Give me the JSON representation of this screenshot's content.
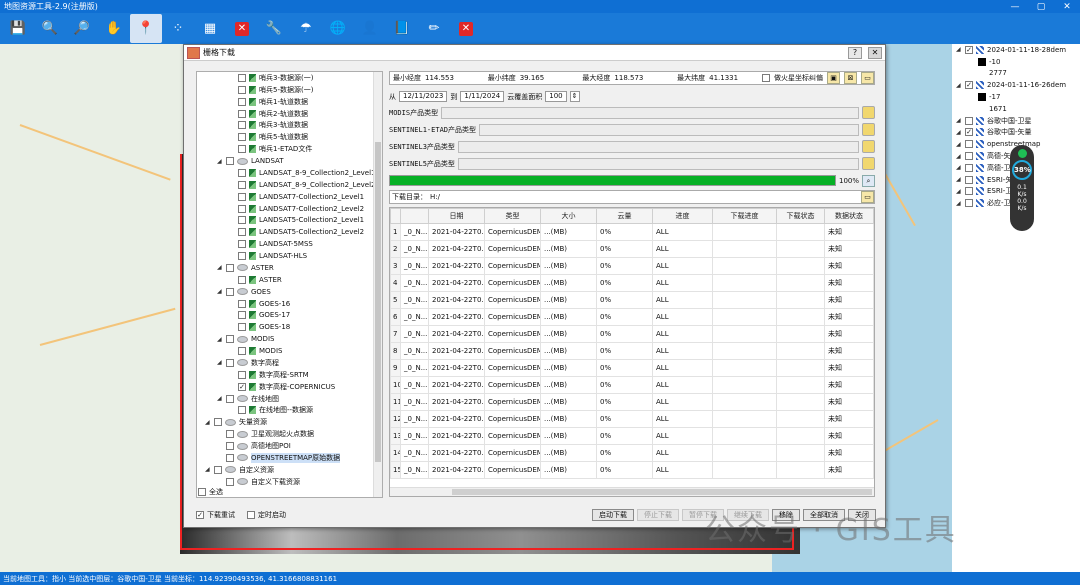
{
  "app": {
    "title": "地图资源工具-2.9(注册版)",
    "min": "—",
    "max": "▢",
    "close": "✕"
  },
  "toolbar": [
    {
      "name": "save-icon",
      "glyph": "💾"
    },
    {
      "name": "zoom-in-icon",
      "glyph": "🔍"
    },
    {
      "name": "zoom-out-icon",
      "glyph": "🔎"
    },
    {
      "name": "pan-hand-icon",
      "glyph": "✋"
    },
    {
      "name": "location-icon",
      "glyph": "📍",
      "active": true
    },
    {
      "name": "select-icon",
      "glyph": "⁘"
    },
    {
      "name": "grid-select-icon",
      "glyph": "▦"
    },
    {
      "name": "clear-icon",
      "glyph": "✕",
      "red": true
    },
    {
      "name": "tools-icon",
      "glyph": "🔧"
    },
    {
      "name": "umbrella-icon",
      "glyph": "☂"
    },
    {
      "name": "globe-icon",
      "glyph": "🌐"
    },
    {
      "name": "user-icon",
      "glyph": "👤"
    },
    {
      "name": "book-icon",
      "glyph": "📘"
    },
    {
      "name": "pencil-icon",
      "glyph": "✏"
    },
    {
      "name": "close-all-icon",
      "glyph": "✕",
      "red": true
    }
  ],
  "layers": [
    {
      "type": "group",
      "checked": true,
      "label": "2024-01-11-18-28dem"
    },
    {
      "type": "value",
      "label": "-10",
      "swatch": true
    },
    {
      "type": "value",
      "label": "2777"
    },
    {
      "type": "group",
      "checked": true,
      "label": "2024-01-11-16-26dem"
    },
    {
      "type": "value",
      "label": "-17",
      "swatch": true
    },
    {
      "type": "value",
      "label": "1671"
    },
    {
      "type": "item",
      "checked": false,
      "label": "谷歌中国-卫星"
    },
    {
      "type": "item",
      "checked": true,
      "label": "谷歌中国-矢量"
    },
    {
      "type": "item",
      "checked": false,
      "label": "openstreetmap"
    },
    {
      "type": "item",
      "checked": false,
      "label": "高德-矢"
    },
    {
      "type": "item",
      "checked": false,
      "label": "高德-卫"
    },
    {
      "type": "item",
      "checked": false,
      "label": "ESRI-矢"
    },
    {
      "type": "item",
      "checked": false,
      "label": "ESRI-卫"
    },
    {
      "type": "item",
      "checked": false,
      "label": "必应-卫"
    }
  ],
  "perf": {
    "cpu": "38%",
    "up": "0.1",
    "up_unit": "K/s",
    "down": "0.0",
    "down_unit": "K/s"
  },
  "status": {
    "text": "当前地图工具：指小  当前选中图层：谷歌中国-卫星  当前坐标：114.92390493536, 41.3166808831161"
  },
  "dialog": {
    "title": "栅格下载",
    "help": "?",
    "close": "✕",
    "tree": [
      {
        "indent": 3,
        "kind": "leaf",
        "checked": false,
        "label": "哨兵3-数据源(一)"
      },
      {
        "indent": 3,
        "kind": "leaf",
        "checked": false,
        "label": "哨兵5-数据源(一)"
      },
      {
        "indent": 3,
        "kind": "leaf",
        "checked": false,
        "label": "哨兵1-轨道数据"
      },
      {
        "indent": 3,
        "kind": "leaf",
        "checked": false,
        "label": "哨兵2-轨道数据"
      },
      {
        "indent": 3,
        "kind": "leaf",
        "checked": false,
        "label": "哨兵3-轨道数据"
      },
      {
        "indent": 3,
        "kind": "leaf",
        "checked": false,
        "label": "哨兵5-轨道数据"
      },
      {
        "indent": 3,
        "kind": "leaf",
        "checked": false,
        "label": "哨兵1-ETAD文件"
      },
      {
        "indent": 2,
        "kind": "folder",
        "checked": false,
        "label": "LANDSAT"
      },
      {
        "indent": 3,
        "kind": "leaf",
        "checked": false,
        "label": "LANDSAT_8-9_Collection2_Level1"
      },
      {
        "indent": 3,
        "kind": "leaf",
        "checked": false,
        "label": "LANDSAT_8-9_Collection2_Level2"
      },
      {
        "indent": 3,
        "kind": "leaf",
        "checked": false,
        "label": "LANDSAT7-Collection2_Level1"
      },
      {
        "indent": 3,
        "kind": "leaf",
        "checked": false,
        "label": "LANDSAT7-Collection2_Level2"
      },
      {
        "indent": 3,
        "kind": "leaf",
        "checked": false,
        "label": "LANDSAT5-Collection2_Level1"
      },
      {
        "indent": 3,
        "kind": "leaf",
        "checked": false,
        "label": "LANDSAT5-Collection2_Level2"
      },
      {
        "indent": 3,
        "kind": "leaf",
        "checked": false,
        "label": "LANDSAT-5MSS"
      },
      {
        "indent": 3,
        "kind": "leaf",
        "checked": false,
        "label": "LANDSAT-HLS"
      },
      {
        "indent": 2,
        "kind": "folder",
        "checked": false,
        "label": "ASTER"
      },
      {
        "indent": 3,
        "kind": "leaf",
        "checked": false,
        "label": "ASTER"
      },
      {
        "indent": 2,
        "kind": "folder",
        "checked": false,
        "label": "GOES"
      },
      {
        "indent": 3,
        "kind": "leaf",
        "checked": false,
        "label": "GOES-16"
      },
      {
        "indent": 3,
        "kind": "leaf",
        "checked": false,
        "label": "GOES-17"
      },
      {
        "indent": 3,
        "kind": "leaf",
        "checked": false,
        "label": "GOES-18"
      },
      {
        "indent": 2,
        "kind": "folder",
        "checked": false,
        "label": "MODIS"
      },
      {
        "indent": 3,
        "kind": "leaf",
        "checked": false,
        "label": "MODIS"
      },
      {
        "indent": 2,
        "kind": "folder",
        "checked": false,
        "label": "数字高程"
      },
      {
        "indent": 3,
        "kind": "leaf",
        "checked": false,
        "label": "数字高程-SRTM"
      },
      {
        "indent": 3,
        "kind": "leaf",
        "checked": true,
        "label": "数字高程-COPERNICUS"
      },
      {
        "indent": 2,
        "kind": "folder",
        "checked": false,
        "label": "在线地图"
      },
      {
        "indent": 3,
        "kind": "leaf",
        "checked": false,
        "label": "在线地图--数据源"
      },
      {
        "indent": 1,
        "kind": "folder",
        "checked": false,
        "label": "矢量资源"
      },
      {
        "indent": 2,
        "kind": "sleaf",
        "checked": false,
        "label": "卫星观测起火点数据"
      },
      {
        "indent": 2,
        "kind": "sleaf",
        "checked": false,
        "label": "高德地图POI"
      },
      {
        "indent": 2,
        "kind": "sleaf",
        "checked": false,
        "label": "OPENSTREETMAP原始数据",
        "selected": true
      },
      {
        "indent": 1,
        "kind": "folder",
        "checked": false,
        "label": "自定义资源"
      },
      {
        "indent": 2,
        "kind": "sleaf",
        "checked": false,
        "label": "自定义下载资源"
      }
    ],
    "check_all": "全选",
    "extent": {
      "min_lon_label": "最小经度",
      "min_lon": "114.553",
      "min_lat_label": "最小纬度",
      "min_lat": "39.165",
      "max_lon_label": "最大经度",
      "max_lon": "118.573",
      "max_lat_label": "最大纬度",
      "max_lat": "41.1331",
      "fire_label": "做火星坐标纠偏"
    },
    "dates": {
      "from_label": "从",
      "from": "12/11/2023",
      "to_label": "到",
      "to": "1/11/2024",
      "cloud_label": "云覆盖面积",
      "cloud": "100"
    },
    "products": [
      {
        "label": "MODIS产品类型"
      },
      {
        "label": "SENTINEL1-ETAD产品类型"
      },
      {
        "label": "SENTINEL3产品类型"
      },
      {
        "label": "SENTINEL5产品类型"
      }
    ],
    "progress": {
      "value": 100,
      "label": "100%"
    },
    "download_dir": {
      "label": "下载目录：",
      "value": "H:/"
    },
    "table": {
      "headers": [
        "",
        "",
        "日期",
        "类型",
        "大小",
        "云量",
        "进度",
        "下载进度",
        "下载状态",
        "数据状态"
      ],
      "rows": [
        [
          "1",
          "_0_N...",
          "2021-04-22T0...",
          "CopernicusDEM",
          "...(MB)",
          "0%",
          "ALL",
          "",
          "",
          "未知"
        ],
        [
          "2",
          "_0_N...",
          "2021-04-22T0...",
          "CopernicusDEM",
          "...(MB)",
          "0%",
          "ALL",
          "",
          "",
          "未知"
        ],
        [
          "3",
          "_0_N...",
          "2021-04-22T0...",
          "CopernicusDEM",
          "...(MB)",
          "0%",
          "ALL",
          "",
          "",
          "未知"
        ],
        [
          "4",
          "_0_N...",
          "2021-04-22T0...",
          "CopernicusDEM",
          "...(MB)",
          "0%",
          "ALL",
          "",
          "",
          "未知"
        ],
        [
          "5",
          "_0_N...",
          "2021-04-22T0...",
          "CopernicusDEM",
          "...(MB)",
          "0%",
          "ALL",
          "",
          "",
          "未知"
        ],
        [
          "6",
          "_0_N...",
          "2021-04-22T0...",
          "CopernicusDEM",
          "...(MB)",
          "0%",
          "ALL",
          "",
          "",
          "未知"
        ],
        [
          "7",
          "_0_N...",
          "2021-04-22T0...",
          "CopernicusDEM",
          "...(MB)",
          "0%",
          "ALL",
          "",
          "",
          "未知"
        ],
        [
          "8",
          "_0_N...",
          "2021-04-22T0...",
          "CopernicusDEM",
          "...(MB)",
          "0%",
          "ALL",
          "",
          "",
          "未知"
        ],
        [
          "9",
          "_0_N...",
          "2021-04-22T0...",
          "CopernicusDEM",
          "...(MB)",
          "0%",
          "ALL",
          "",
          "",
          "未知"
        ],
        [
          "10",
          "_0_N...",
          "2021-04-22T0...",
          "CopernicusDEM",
          "...(MB)",
          "0%",
          "ALL",
          "",
          "",
          "未知"
        ],
        [
          "11",
          "_0_N...",
          "2021-04-22T0...",
          "CopernicusDEM",
          "...(MB)",
          "0%",
          "ALL",
          "",
          "",
          "未知"
        ],
        [
          "12",
          "_0_N...",
          "2021-04-22T0...",
          "CopernicusDEM",
          "...(MB)",
          "0%",
          "ALL",
          "",
          "",
          "未知"
        ],
        [
          "13",
          "_0_N...",
          "2021-04-22T0...",
          "CopernicusDEM",
          "...(MB)",
          "0%",
          "ALL",
          "",
          "",
          "未知"
        ],
        [
          "14",
          "_0_N...",
          "2021-04-22T0...",
          "CopernicusDEM",
          "...(MB)",
          "0%",
          "ALL",
          "",
          "",
          "未知"
        ],
        [
          "15",
          "_0_N...",
          "2021-04-22T0...",
          "CopernicusDEM",
          "...(MB)",
          "0%",
          "ALL",
          "",
          "",
          "未知"
        ]
      ]
    },
    "options": {
      "retry": "下载重试",
      "retry_checked": true,
      "timer": "定时启动",
      "timer_checked": false
    },
    "buttons": [
      {
        "name": "start-download-button",
        "label": "启动下载",
        "disabled": false
      },
      {
        "name": "stop-download-button",
        "label": "停止下载",
        "disabled": true
      },
      {
        "name": "pause-download-button",
        "label": "暂停下载",
        "disabled": true
      },
      {
        "name": "resume-download-button",
        "label": "继续下载",
        "disabled": true
      },
      {
        "name": "remove-button",
        "label": "移除",
        "disabled": false
      },
      {
        "name": "cancel-all-button",
        "label": "全部取消",
        "disabled": false
      },
      {
        "name": "close-button",
        "label": "关闭",
        "disabled": false
      }
    ]
  },
  "watermark": "公众号 · GIS工具"
}
